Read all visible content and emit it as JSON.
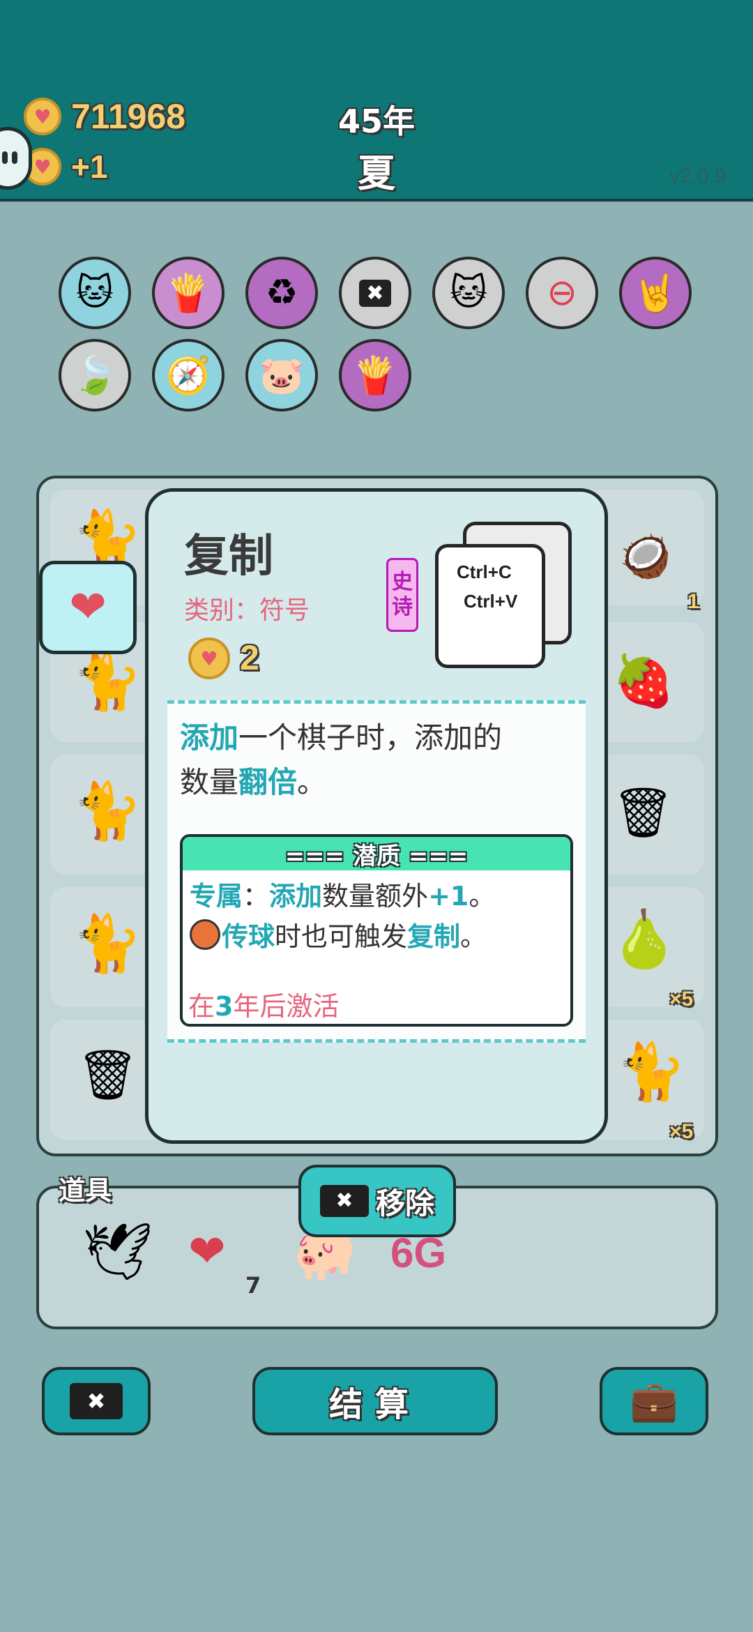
{
  "header": {
    "coins": "711968",
    "income": "+1",
    "year": "45年",
    "season": "夏",
    "version": "v2.0.9"
  },
  "symbols_row1": [
    "cat-icon",
    "fries-icon",
    "recycle-icon",
    "remove-tag-icon",
    "double-cat-icon",
    "minus-icon",
    "rock-hand-icon"
  ],
  "symbols_row2": [
    "leaf-icon",
    "compass-icon",
    "piggy-bank-icon",
    "fries-icon"
  ],
  "board_side_counts": {
    "c1": "1",
    "c4": "×5",
    "c5": "×5"
  },
  "card": {
    "title": "复制",
    "category_label": "类别：符号",
    "cost": "2",
    "rarity": [
      "史",
      "诗"
    ],
    "kb1": "Ctrl+C",
    "kb2": "Ctrl+V",
    "desc_p1": "添加",
    "desc_p2": "一个棋子时，添加的",
    "desc_p3": "数量",
    "desc_p4": "翻倍",
    "desc_p5": "。",
    "trait_title": "=== 潜质 ===",
    "trait_l1": [
      {
        "t": "专属",
        "c": "teal"
      },
      {
        "t": "：",
        "c": "plain"
      },
      {
        "t": "添加",
        "c": "teal"
      },
      {
        "t": "数量额外",
        "c": "plain"
      },
      {
        "t": "+1",
        "c": "teal"
      },
      {
        "t": "。",
        "c": "plain"
      }
    ],
    "trait_l2": [
      {
        "t": "传球",
        "c": "teal"
      },
      {
        "t": "时也可触发",
        "c": "plain"
      },
      {
        "t": "复制",
        "c": "teal"
      },
      {
        "t": "。",
        "c": "plain"
      }
    ],
    "activate_p1": "在",
    "activate_p2": "3",
    "activate_p3": "年后激活"
  },
  "items_label": "道具",
  "items_liver_count": "7",
  "remove_button": "移除",
  "settle_button": "结算",
  "colors": {
    "header": "#0e7675",
    "accent": "#1aa3a6",
    "trait_header": "#48e3b3",
    "pink_text": "#e6657e"
  }
}
